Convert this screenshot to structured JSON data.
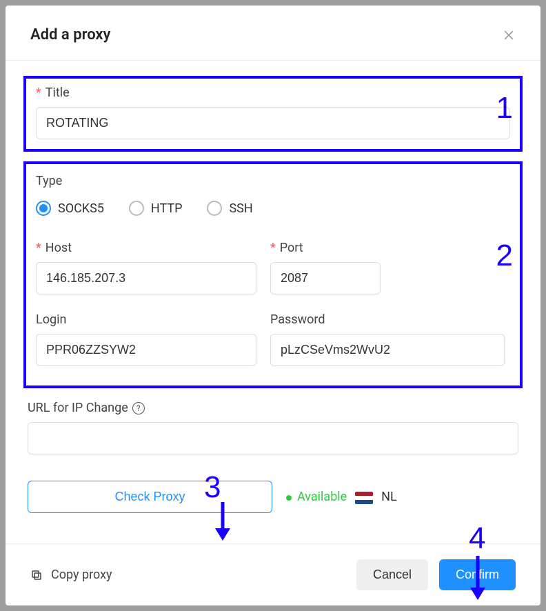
{
  "modal": {
    "title": "Add a proxy"
  },
  "title_field": {
    "label": "Title",
    "value": "ROTATING"
  },
  "type_field": {
    "label": "Type",
    "options": [
      "SOCKS5",
      "HTTP",
      "SSH"
    ],
    "selected": "SOCKS5"
  },
  "host_field": {
    "label": "Host",
    "value": "146.185.207.3"
  },
  "port_field": {
    "label": "Port",
    "value": "2087"
  },
  "login_field": {
    "label": "Login",
    "value": "PPR06ZZSYW2"
  },
  "password_field": {
    "label": "Password",
    "value": "pLzCSeVms2WvU2"
  },
  "url_field": {
    "label": "URL for IP Change",
    "value": ""
  },
  "check_button": "Check Proxy",
  "status": {
    "text": "Available",
    "country_code": "NL"
  },
  "footer": {
    "copy_label": "Copy proxy",
    "cancel": "Cancel",
    "confirm": "Confirm"
  },
  "annotations": {
    "n1": "1",
    "n2": "2",
    "n3": "3",
    "n4": "4"
  }
}
